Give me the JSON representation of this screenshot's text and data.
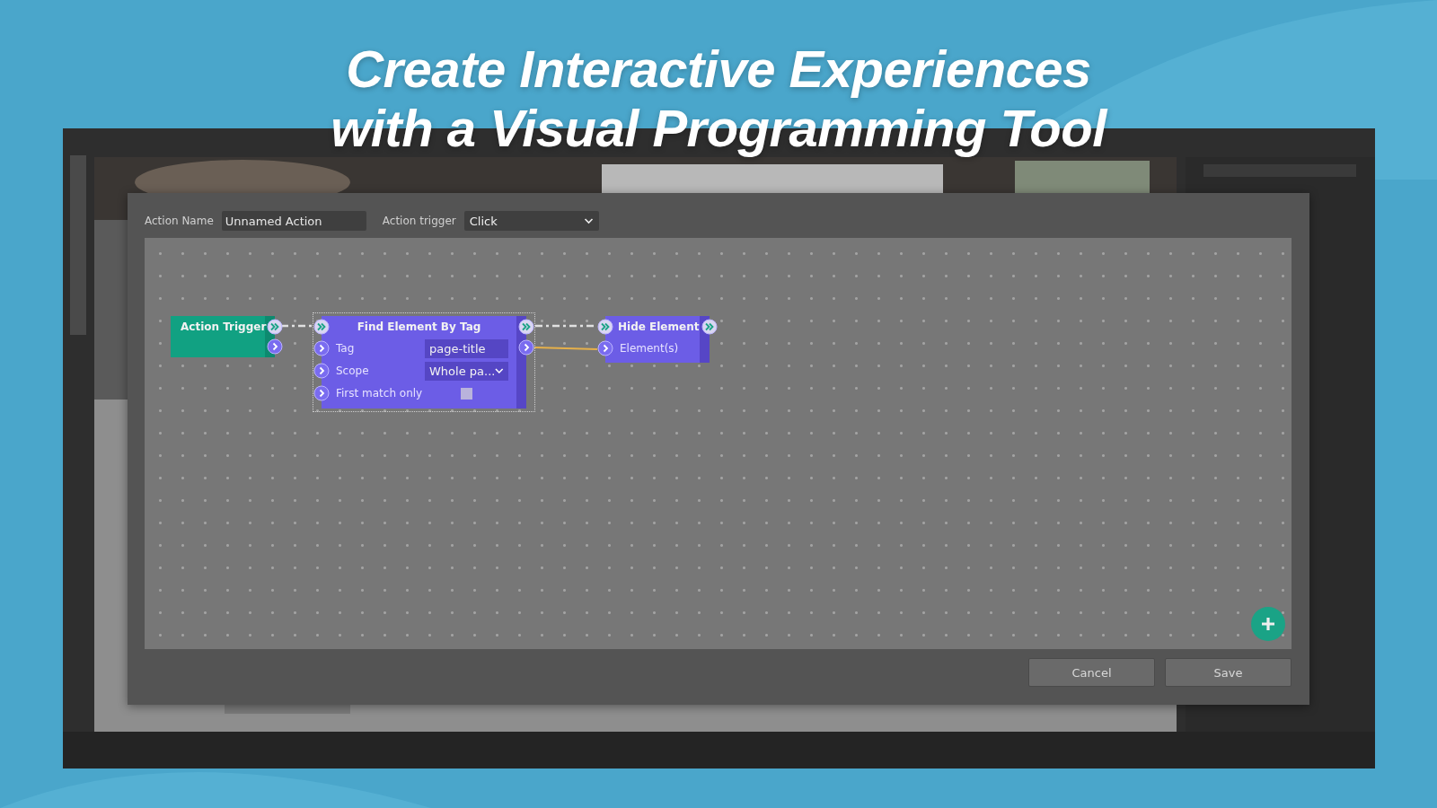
{
  "headline": [
    "Create Interactive Experiences",
    "with a Visual Programming Tool"
  ],
  "dialog": {
    "action_name": {
      "label": "Action Name",
      "value": "Unnamed Action"
    },
    "action_trigger": {
      "label": "Action trigger",
      "value": "Click"
    },
    "nodes": [
      {
        "kind": "trigger",
        "title": "Action Trigger",
        "selected": false
      },
      {
        "kind": "action",
        "title": "Find Element By Tag",
        "selected": true,
        "inputs": [
          {
            "kind": "text",
            "label": "Tag",
            "value": "page-title"
          },
          {
            "kind": "select",
            "label": "Scope",
            "value": "Whole pa..."
          },
          {
            "kind": "checkbox",
            "label": "First match only",
            "checked": false
          }
        ]
      },
      {
        "kind": "action",
        "title": "Hide Element",
        "selected": false,
        "inputs": [
          {
            "kind": "port",
            "label": "Element(s)"
          }
        ]
      }
    ],
    "buttons": [
      "Cancel",
      "Save"
    ]
  }
}
